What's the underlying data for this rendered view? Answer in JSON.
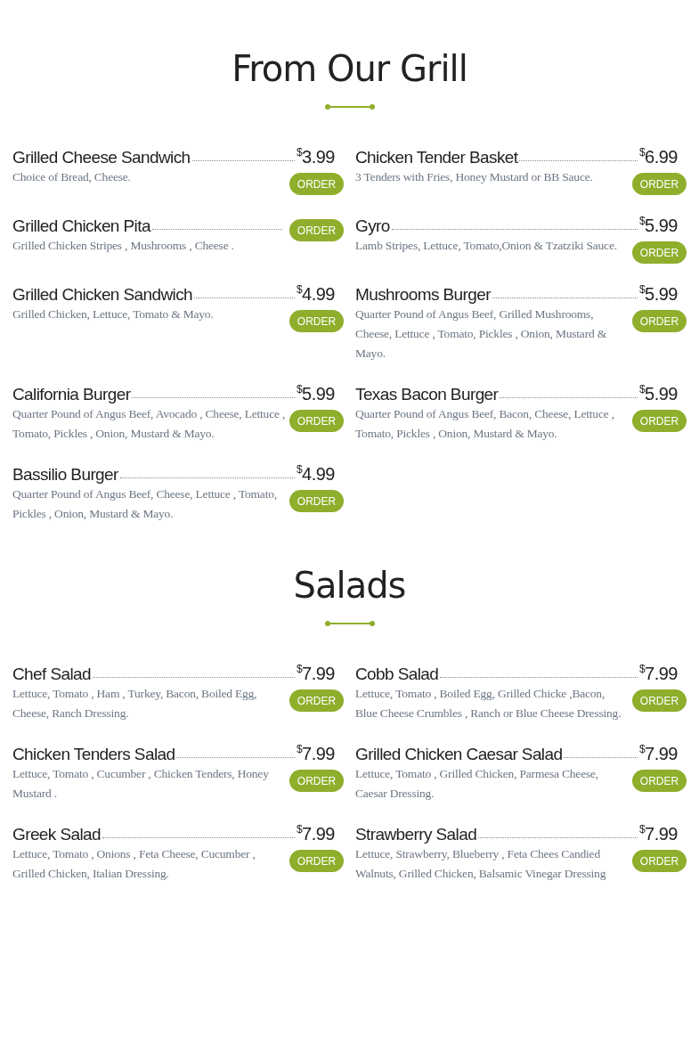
{
  "sections": [
    {
      "title": "From Our Grill",
      "items": [
        {
          "name": "Grilled Cheese Sandwich",
          "currency": "$",
          "price": "3.99",
          "description": "Choice of Bread, Cheese.",
          "button": "ORDER"
        },
        {
          "name": "Chicken Tender Basket",
          "currency": "$",
          "price": "6.99",
          "description": "3 Tenders with Fries, Honey Mustard or BB Sauce.",
          "button": "ORDER"
        },
        {
          "name": "Grilled Chicken Pita",
          "description": "Grilled Chicken Stripes , Mushrooms , Cheese .",
          "button": "ORDER"
        },
        {
          "name": "Gyro",
          "currency": "$",
          "price": "5.99",
          "description": "Lamb Stripes, Lettuce, Tomato,Onion & Tzatziki Sauce.",
          "button": "ORDER"
        },
        {
          "name": "Grilled Chicken Sandwich",
          "currency": "$",
          "price": "4.99",
          "description": "Grilled Chicken, Lettuce, Tomato & Mayo.",
          "button": "ORDER"
        },
        {
          "name": "Mushrooms Burger",
          "currency": "$",
          "price": "5.99",
          "description": "Quarter Pound of Angus Beef, Grilled Mushrooms, Cheese, Lettuce , Tomato, Pickles , Onion, Mustard & Mayo.",
          "button": "ORDER"
        },
        {
          "name": "California Burger",
          "currency": "$",
          "price": "5.99",
          "description": "Quarter Pound of Angus Beef, Avocado , Cheese, Lettuce , Tomato, Pickles , Onion, Mustard & Mayo.",
          "button": "ORDER"
        },
        {
          "name": "Texas Bacon Burger",
          "currency": "$",
          "price": "5.99",
          "description": "Quarter Pound of Angus Beef, Bacon, Cheese, Lettuce , Tomato, Pickles , Onion, Mustard & Mayo.",
          "button": "ORDER"
        },
        {
          "name": "Bassilio Burger",
          "currency": "$",
          "price": "4.99",
          "description": "Quarter Pound of Angus Beef, Cheese, Lettuce , Tomato, Pickles , Onion, Mustard & Mayo.",
          "button": "ORDER"
        }
      ]
    },
    {
      "title": "Salads",
      "items": [
        {
          "name": "Chef Salad",
          "currency": "$",
          "price": "7.99",
          "description": "Lettuce, Tomato , Ham , Turkey, Bacon, Boiled Egg, Cheese, Ranch Dressing.",
          "button": "ORDER"
        },
        {
          "name": "Cobb Salad",
          "currency": "$",
          "price": "7.99",
          "description": "Lettuce, Tomato , Boiled Egg, Grilled Chicke ,Bacon, Blue Cheese Crumbles , Ranch or Blue Cheese Dressing.",
          "button": "ORDER"
        },
        {
          "name": "Chicken Tenders Salad",
          "currency": "$",
          "price": "7.99",
          "description": "Lettuce, Tomato , Cucumber , Chicken Tenders, Honey Mustard .",
          "button": "ORDER"
        },
        {
          "name": "Grilled Chicken Caesar Salad",
          "currency": "$",
          "price": "7.99",
          "description": "Lettuce, Tomato , Grilled Chicken, Parmesa Cheese, Caesar Dressing.",
          "button": "ORDER"
        },
        {
          "name": "Greek Salad",
          "currency": "$",
          "price": "7.99",
          "description": "Lettuce, Tomato , Onions , Feta Cheese, Cucumber , Grilled Chicken, Italian Dressing.",
          "button": "ORDER"
        },
        {
          "name": "Strawberry Salad",
          "currency": "$",
          "price": "7.99",
          "description": "Lettuce, Strawberry, Blueberry , Feta Chees Candied Walnuts, Grilled Chicken, Balsamic Vinegar Dressing",
          "button": "ORDER"
        }
      ]
    }
  ]
}
